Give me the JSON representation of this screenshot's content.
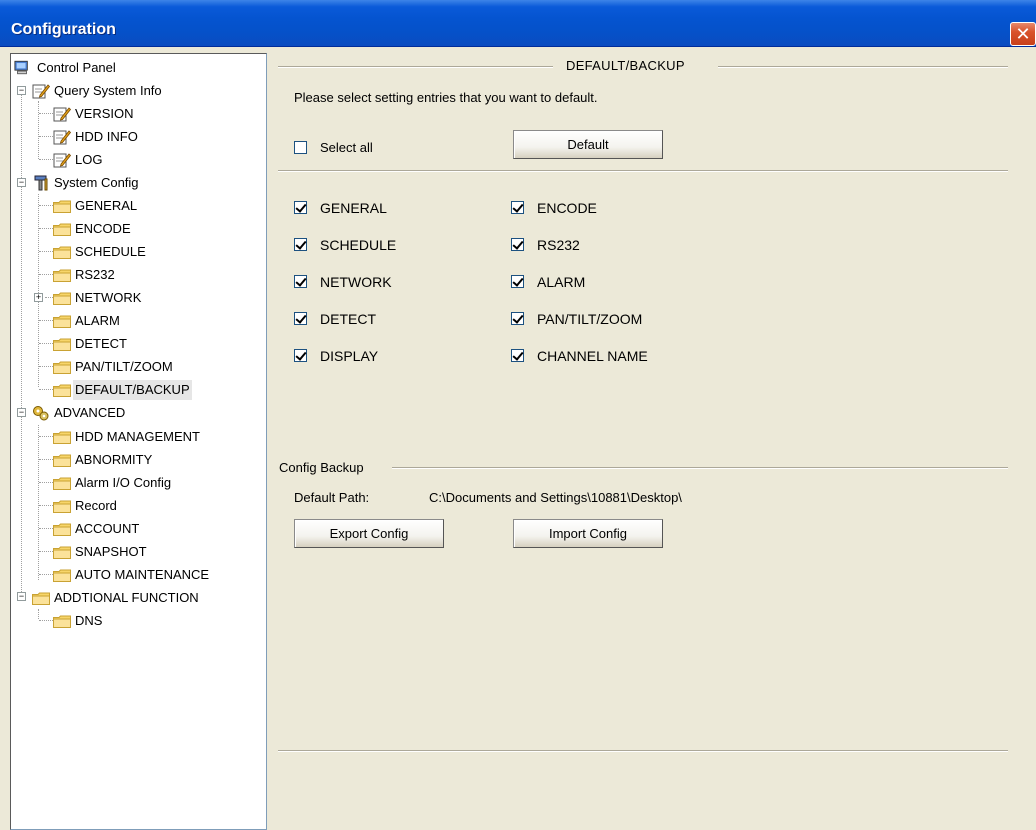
{
  "window": {
    "title": "Configuration",
    "close_glyph": "✕"
  },
  "tree": [
    {
      "label": "Control Panel",
      "icon": "computer-icon"
    },
    {
      "label": "Query System Info",
      "icon": "edit-icon",
      "expanded": true
    },
    {
      "label": "VERSION",
      "icon": "edit-icon"
    },
    {
      "label": "HDD INFO",
      "icon": "edit-icon"
    },
    {
      "label": "LOG",
      "icon": "edit-icon"
    },
    {
      "label": "System Config",
      "icon": "tools-icon",
      "expanded": true
    },
    {
      "label": "GENERAL",
      "icon": "folder-icon"
    },
    {
      "label": "ENCODE",
      "icon": "folder-icon"
    },
    {
      "label": "SCHEDULE",
      "icon": "folder-icon"
    },
    {
      "label": "RS232",
      "icon": "folder-icon"
    },
    {
      "label": "NETWORK",
      "icon": "folder-icon",
      "expanded": false
    },
    {
      "label": "ALARM",
      "icon": "folder-icon"
    },
    {
      "label": "DETECT",
      "icon": "folder-icon"
    },
    {
      "label": "PAN/TILT/ZOOM",
      "icon": "folder-icon"
    },
    {
      "label": "DEFAULT/BACKUP",
      "icon": "folder-icon",
      "selected": true
    },
    {
      "label": "ADVANCED",
      "icon": "gears-icon",
      "expanded": true
    },
    {
      "label": "HDD MANAGEMENT",
      "icon": "folder-icon"
    },
    {
      "label": "ABNORMITY",
      "icon": "folder-icon"
    },
    {
      "label": "Alarm I/O Config",
      "icon": "folder-icon"
    },
    {
      "label": "Record",
      "icon": "folder-icon"
    },
    {
      "label": "ACCOUNT",
      "icon": "folder-icon"
    },
    {
      "label": "SNAPSHOT",
      "icon": "folder-icon"
    },
    {
      "label": "AUTO MAINTENANCE",
      "icon": "folder-icon"
    },
    {
      "label": "ADDTIONAL FUNCTION",
      "icon": "folder-icon",
      "expanded": true
    },
    {
      "label": "DNS",
      "icon": "folder-icon"
    }
  ],
  "default_section": {
    "header": "DEFAULT/BACKUP",
    "instruction": "Please select setting entries that you want to default.",
    "select_all_label": "Select all",
    "select_all_checked": false,
    "default_button": "Default",
    "options": [
      {
        "label": "GENERAL",
        "checked": true
      },
      {
        "label": "ENCODE",
        "checked": true
      },
      {
        "label": "SCHEDULE",
        "checked": true
      },
      {
        "label": "RS232",
        "checked": true
      },
      {
        "label": "NETWORK",
        "checked": true
      },
      {
        "label": "ALARM",
        "checked": true
      },
      {
        "label": "DETECT",
        "checked": true
      },
      {
        "label": "PAN/TILT/ZOOM",
        "checked": true
      },
      {
        "label": "DISPLAY",
        "checked": true
      },
      {
        "label": "CHANNEL NAME",
        "checked": true
      }
    ]
  },
  "backup_section": {
    "header": "Config Backup",
    "path_label": "Default Path:",
    "path_value": "C:\\Documents and Settings\\10881\\Desktop\\",
    "export_button": "Export Config",
    "import_button": "Import Config"
  },
  "colors": {
    "titlebar": "#0554d0",
    "window_bg": "#ece9d8",
    "close_button": "#d9532c"
  }
}
